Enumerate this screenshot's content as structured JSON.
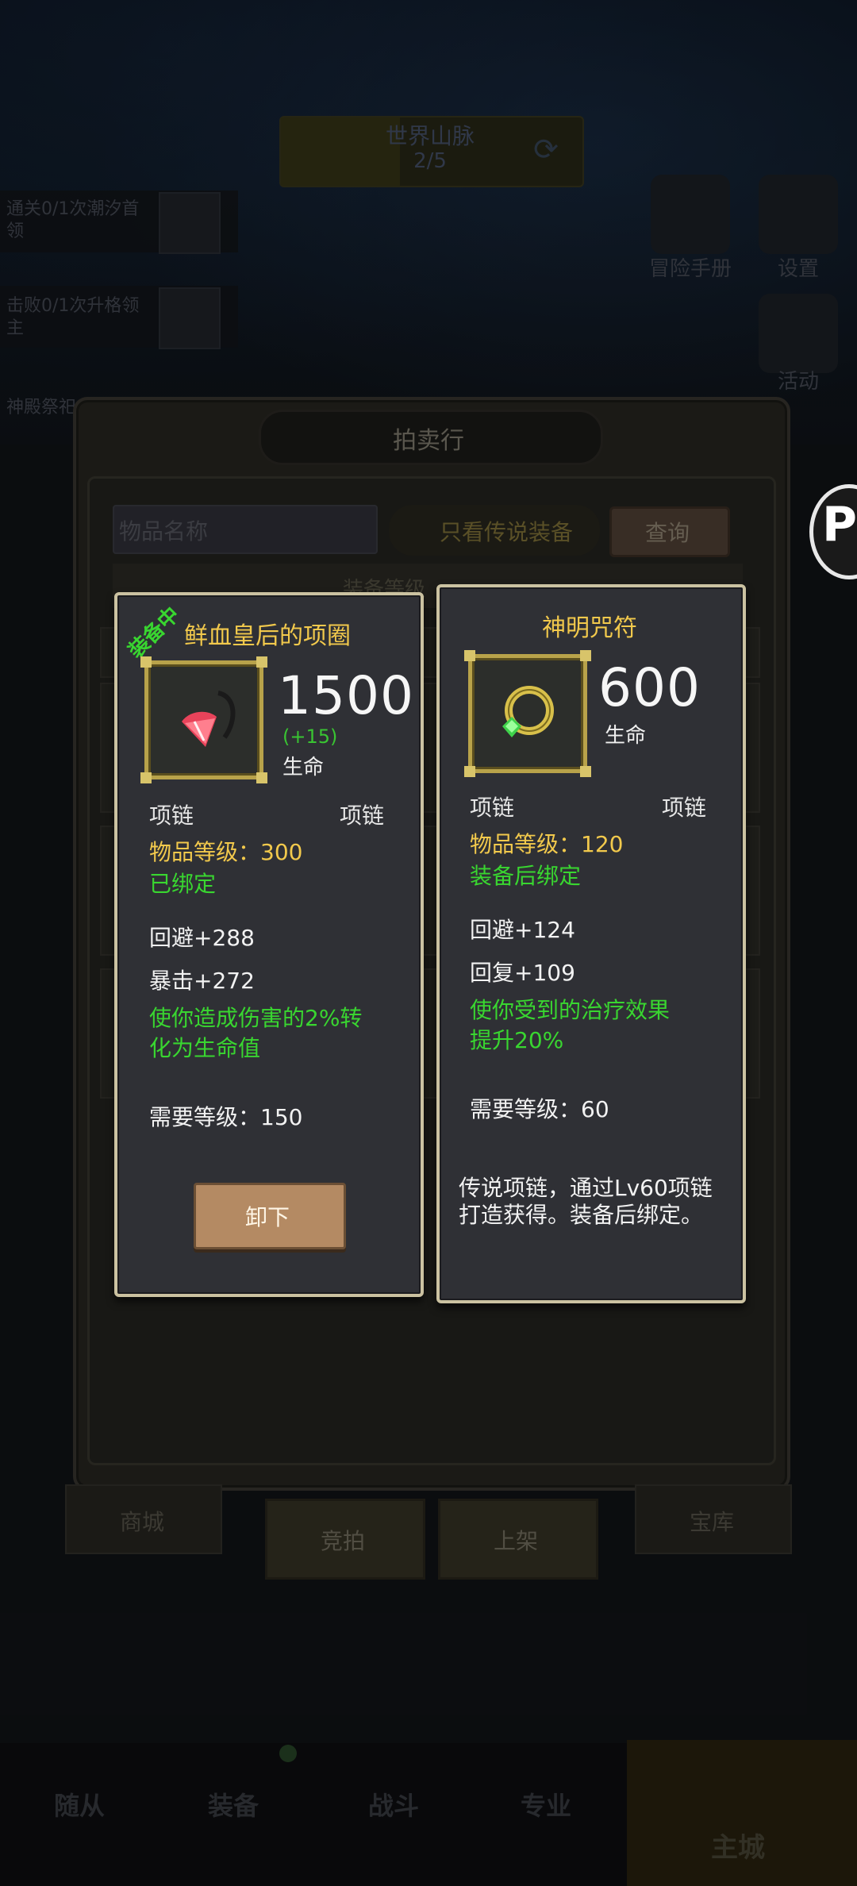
{
  "background": {
    "world_title": "世界山脉",
    "world_progress": "2/5",
    "quests": [
      {
        "text": "通关0/1次潮汐首领"
      },
      {
        "text": "击败0/1次升格领主"
      },
      {
        "text": "神殿祭祀"
      }
    ],
    "side_menu": [
      {
        "label": "冒险手册",
        "icon": "book-icon"
      },
      {
        "label": "设置",
        "icon": "gear-icon"
      },
      {
        "label": "活动",
        "icon": "calendar-icon"
      }
    ],
    "bottom_tabs": [
      {
        "label": "商城"
      },
      {
        "label": "宝库"
      }
    ],
    "bottom_nav": [
      {
        "label": "随从"
      },
      {
        "label": "装备"
      },
      {
        "label": "战斗"
      },
      {
        "label": "专业"
      },
      {
        "label": "主城"
      }
    ]
  },
  "auction": {
    "title": "拍卖行",
    "search_placeholder": "物品名称",
    "legend_toggle": "只看传说装备",
    "query_button": "查询",
    "filter_label": "装备等级",
    "actions": [
      {
        "label": "竞拍"
      },
      {
        "label": "上架"
      }
    ]
  },
  "equipped_item": {
    "badge": "装备中",
    "name": "鲜血皇后的项圈",
    "main_value": "1500",
    "main_bonus": "(+15)",
    "main_stat": "生命",
    "type_left": "项链",
    "type_right": "项链",
    "item_level": "物品等级：300",
    "bind_status": "已绑定",
    "stats": [
      "回避+288",
      "暴击+272"
    ],
    "effect": "使你造成伤害的2%转化为生命值",
    "required_level": "需要等级：150",
    "unequip_button": "卸下",
    "icon": "ruby-necklace-icon"
  },
  "compare_item": {
    "name": "神明咒符",
    "main_value": "600",
    "main_stat": "生命",
    "type_left": "项链",
    "type_right": "项链",
    "item_level": "物品等级：120",
    "bind_status": "装备后绑定",
    "stats": [
      "回避+124",
      "回复+109"
    ],
    "effect": "使你受到的治疗效果提升20%",
    "required_level": "需要等级：60",
    "description": "传说项链，通过Lv60项链打造获得。装备后绑定。",
    "icon": "emerald-amulet-icon"
  },
  "floating_button": {
    "glyph": "P"
  },
  "colors": {
    "gold_text": "#f2c94c",
    "green_text": "#39d630",
    "card_border": "#cbc2a1",
    "card_bg": "#2f3035",
    "frame_gold": "#b8a24a"
  }
}
